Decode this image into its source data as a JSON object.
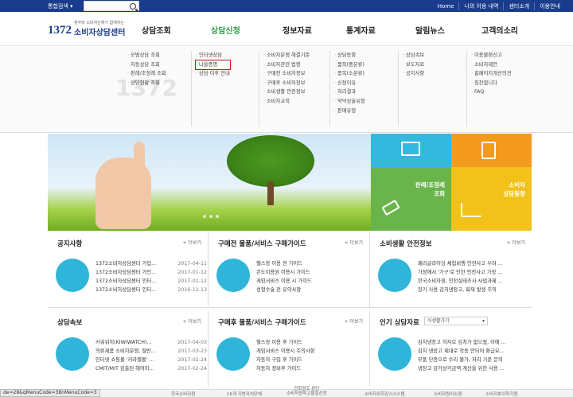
{
  "topbar": {
    "search_label": "통합검색 ▾",
    "links": [
      "Home",
      "나의 이용 내역",
      "센터소개",
      "이용안내"
    ]
  },
  "logo": {
    "number": "1372",
    "subtitle": "정부와 소비자단체가 함께하는",
    "title": "소비자상담센터"
  },
  "gnb": [
    "상담조회",
    "상담신청",
    "정보자료",
    "통계자료",
    "알림뉴스",
    "고객의소리"
  ],
  "mega": {
    "col1": [
      "모범상담 조회",
      "자동상담 조회",
      "판례/조정례 조회",
      "상담현황 조회"
    ],
    "col2": [
      "인터넷상담",
      "나을증명",
      "상담 이후 안내"
    ],
    "col3": [
      "소비자분쟁 해결기준",
      "소비자관련 법령",
      "구매전 소비자정보",
      "구매후 소비자정보",
      "소비생활 안전정보",
      "소비자교육"
    ],
    "col4": [
      "상담동향",
      "품목(중분류)",
      "품목(소분류)",
      "신청이유",
      "처리결과",
      "악덕상술유형",
      "판매유형"
    ],
    "col5": [
      "상담속보",
      "보도자료",
      "공지사항"
    ],
    "col6": [
      "이용불편신고",
      "소비자제안",
      "홈페이지개선의견",
      "칭찬합니다",
      "FAQ"
    ]
  },
  "tiles": {
    "t3": "판례/조정례\n조회",
    "t4": "소비자\n상담동향"
  },
  "sections": {
    "notice": {
      "title": "공지사항",
      "more": "+ 더보기",
      "items": [
        [
          "1372소비자상담센터 가입...",
          "2017-04-11"
        ],
        [
          "1372소비자상담센터 가인...",
          "2017-01-12"
        ],
        [
          "1372소비자상담센터 인터...",
          "2017-01-12"
        ],
        [
          "1372소비자상담센터 인터...",
          "2016-12-13"
        ]
      ]
    },
    "before": {
      "title": "구매전 물품/서비스 구매가이드",
      "more": "+ 더보기",
      "items": [
        "헬스장 이용 전 가이드",
        "콘도이용원 이용시 가이드",
        "게임서비스 이용 시 가이드",
        "성형수술 전 유의사항"
      ]
    },
    "safety": {
      "title": "소비생활 안전정보",
      "more": "+ 더보기",
      "items": [
        "패러글라이딩 체험비행 안전사고 우려 ...",
        "가정에서 '가구'로 인한 안전사고 가장 ...",
        "한국소비자원, 안전실태조사 사업과제 ...",
        "장기 사용 김치냉장고, 화재 발생 주의"
      ]
    },
    "news": {
      "title": "상담속보",
      "more": "+ 더보기",
      "items": [
        [
          "키워워치(KIWIWATCH)...",
          "2017-04-03"
        ],
        [
          "의류제품 소비자분쟁, 절반...",
          "2017-03-23"
        ],
        [
          "인터넷 쇼핑몰 '키라멜몰' ...",
          "2017-02-24"
        ],
        [
          "CMIT/MIT 검출된 헤어미...",
          "2017-02-24"
        ]
      ]
    },
    "after": {
      "title": "구매후 물품/서비스 구매가이드",
      "more": "+ 더보기",
      "items": [
        "헬스장 이용 후 가이드",
        "게임서비스 이용시 주의사항",
        "자동차 구입 후 가이드",
        "자동차 정비후 가이드"
      ]
    },
    "popular": {
      "title": "인기 상담자료",
      "select": "식생활가기",
      "items": [
        "김치냉장고 하자로 김치가 없으졌, 이에 ...",
        "김치 냉장고 제대로 작동 안되어 환급요...",
        "부품 단종으로 수리 불가, 처리 기준 문의",
        "냉장고 감가상각금액 계산을 위한 사용 ..."
      ]
    }
  },
  "footer": [
    "한국소비자원",
    "16개 지방자치단체",
    "전화원조 판단\n소비자원학고물질선정",
    "소비자위하감시시스템",
    "소비자원아소원",
    "소비자호이학기원"
  ],
  "statusbar": "de=28&qMenuCode=38nMenuCode=3",
  "colors": {
    "topbar": "#1a3c8c",
    "active_menu": "#2e9c4a",
    "tile_blue": "#35b8e0",
    "tile_orange": "#f39a1e",
    "tile_green": "#6ab54b",
    "tile_yellow": "#f2c21a"
  }
}
